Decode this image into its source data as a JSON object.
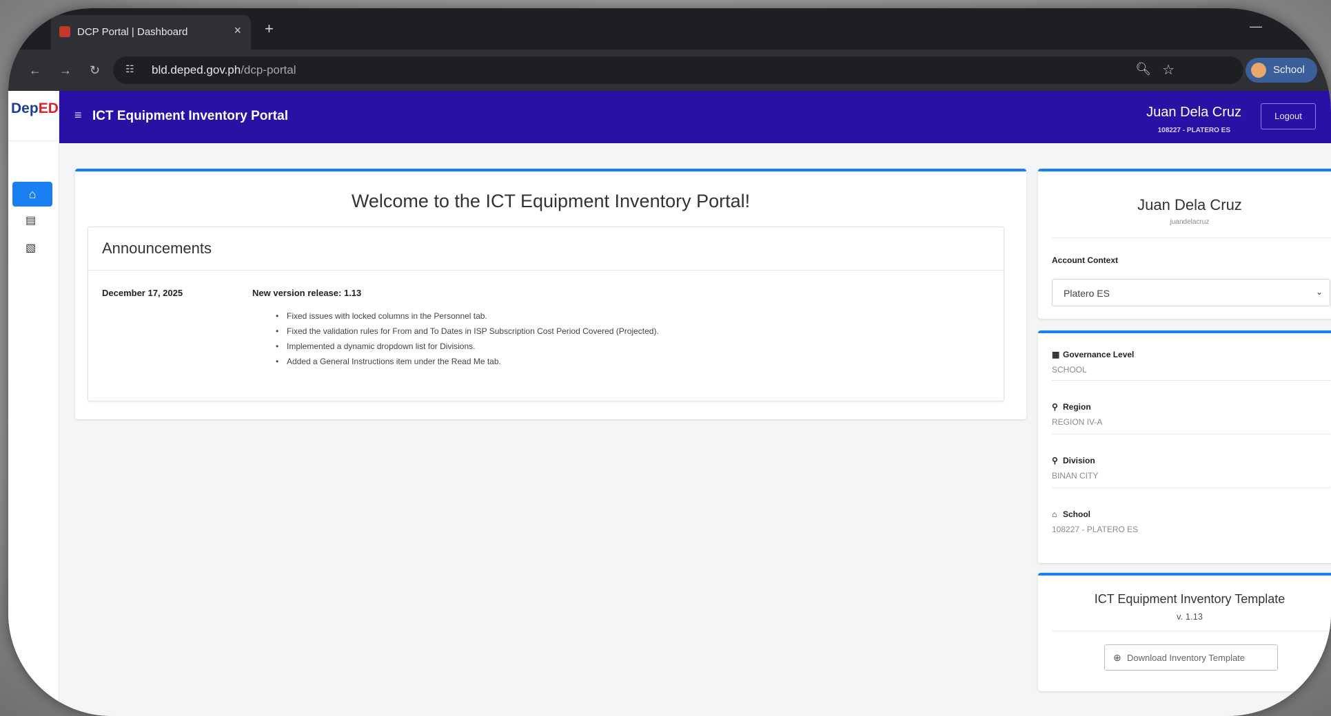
{
  "browser": {
    "tab_title": "DCP Portal | Dashboard",
    "tab_close": "×",
    "new_tab": "+",
    "minimize": "—",
    "url_host": "bld.deped.gov.ph",
    "url_path": "/dcp-portal",
    "profile_label": "School"
  },
  "sidebar": {
    "logo_blue": "Dep",
    "logo_red": "ED"
  },
  "header": {
    "title": "ICT Equipment Inventory Portal",
    "user_name": "Juan Dela Cruz",
    "user_sub": "108227 - PLATERO ES",
    "logout_label": "Logout"
  },
  "main": {
    "welcome": "Welcome to the ICT Equipment Inventory Portal!",
    "announcements_heading": "Announcements",
    "announcement": {
      "date": "December 17, 2025",
      "title": "New version release: 1.13",
      "items": [
        "Fixed issues with locked columns in the Personnel tab.",
        "Fixed the validation rules for From and To Dates in ISP Subscription Cost Period Covered (Projected).",
        "Implemented a dynamic dropdown list for Divisions.",
        "Added a General Instructions item under the Read Me tab."
      ]
    }
  },
  "profile": {
    "name": "Juan Dela Cruz",
    "username": "juandelacruz",
    "context_label": "Account Context",
    "context_value": "Platero ES"
  },
  "info": {
    "governance_label": "Governance Level",
    "governance_value": "SCHOOL",
    "region_label": "Region",
    "region_value": "REGION IV-A",
    "division_label": "Division",
    "division_value": "BINAN CITY",
    "school_label": "School",
    "school_value": "108227 - PLATERO ES"
  },
  "template": {
    "title": "ICT Equipment Inventory Template",
    "version": "v. 1.13",
    "download_label": "Download Inventory Template"
  },
  "colors": {
    "header_bg": "#2a11a6",
    "accent": "#1a7ff0"
  }
}
